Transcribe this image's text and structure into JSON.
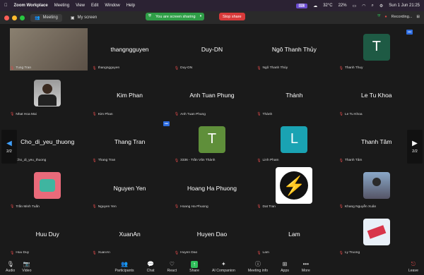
{
  "macbar": {
    "app": "Zoom Workplace",
    "menus": [
      "Meeting",
      "View",
      "Edit",
      "Window",
      "Help"
    ],
    "temp": "32°C",
    "battery": "22%",
    "datetime": "Sun 1 Jun  21:25"
  },
  "titlebar": {
    "tab_meeting": "Meeting",
    "tab_screen": "My screen",
    "sharing_text": "You are screen sharing",
    "stop_share": "Stop share",
    "recording": "Recording..."
  },
  "nav": {
    "page_left": "2/2",
    "page_right": "2/2"
  },
  "tiles": [
    {
      "type": "video",
      "label": "Tung Tran"
    },
    {
      "type": "name",
      "display": "thangngguyen",
      "label": "thangngguyen"
    },
    {
      "type": "name",
      "display": "Duy-DN",
      "label": "Duy-DN"
    },
    {
      "type": "name",
      "display": "Ngô Thanh Thủy",
      "label": "Ngô Thanh Thủy"
    },
    {
      "type": "letter",
      "letter": "T",
      "color": "#1e5a44",
      "label": "Thanh Thuy"
    },
    {
      "type": "photo",
      "label": "Nhat Hoa Mai"
    },
    {
      "type": "name",
      "display": "Kim Phan",
      "label": "Kim Phan"
    },
    {
      "type": "name",
      "display": "Anh Tuan Phung",
      "label": "Anh Tuan Phung"
    },
    {
      "type": "name",
      "display": "Thành",
      "label": "Thành"
    },
    {
      "type": "name",
      "display": "Le Tu Khoa",
      "label": "Le Tu Khoa"
    },
    {
      "type": "name",
      "display": "Cho_di_yeu_thuong",
      "label": "Cho_di_yeu_thuong"
    },
    {
      "type": "name",
      "display": "Thang Tran",
      "label": "Thang Tran"
    },
    {
      "type": "letter",
      "letter": "T",
      "color": "#5f8f3a",
      "label": "3336 - Trần Văn Thành"
    },
    {
      "type": "letter",
      "letter": "L",
      "color": "#1aa3b3",
      "label": "Linh Pham"
    },
    {
      "type": "name",
      "display": "Thanh Tâm",
      "label": "Thanh Tâm"
    },
    {
      "type": "photo2",
      "label": "Trần Minh Tuấn"
    },
    {
      "type": "name",
      "display": "Nguyen Yen",
      "label": "Nguyen Yen"
    },
    {
      "type": "name",
      "display": "Hoang Ha Phuong",
      "label": "Hoang Ha Phuong"
    },
    {
      "type": "bolt",
      "label": "Dat Tran"
    },
    {
      "type": "photo3",
      "label": "Khang Nguyễn Xuân"
    },
    {
      "type": "name",
      "display": "Huu Duy",
      "label": "Huu Duy"
    },
    {
      "type": "name",
      "display": "XuanAn",
      "label": "XuanAn"
    },
    {
      "type": "name",
      "display": "Huyen Dao",
      "label": "Huyen Dao"
    },
    {
      "type": "name",
      "display": "Lam",
      "label": "Lam"
    },
    {
      "type": "photo4",
      "label": "Ly Truong"
    }
  ],
  "toolbar": {
    "audio": "Audio",
    "video": "Video",
    "participants": "Participants",
    "participants_count": "34",
    "chat": "Chat",
    "chat_badge": "4",
    "react": "React",
    "share": "Share",
    "ai": "AI Companion",
    "info": "Meeting info",
    "apps": "Apps",
    "more": "More",
    "leave": "Leave"
  }
}
